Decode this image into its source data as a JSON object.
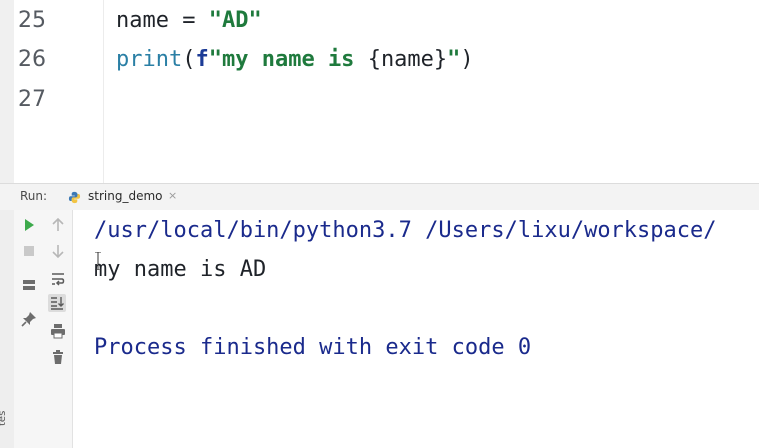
{
  "editor": {
    "lines": [
      {
        "number": "25",
        "tokens": {
          "ident": "name",
          "op": " = ",
          "str": "\"AD\""
        }
      },
      {
        "number": "26",
        "tokens": {
          "builtin": "print",
          "open": "(",
          "prefix": "f",
          "str1": "\"my name is ",
          "brace_open": "{",
          "var": "name",
          "brace_close": "}",
          "str2": "\"",
          "close": ")"
        }
      },
      {
        "number": "27"
      }
    ]
  },
  "run_window": {
    "label": "Run:",
    "tab": {
      "title": "string_demo",
      "close": "×",
      "icon": "python-icon"
    },
    "toolbar": [
      "run-icon",
      "stop-icon",
      "layout-icon",
      "pin-icon",
      "up-arrow-icon",
      "down-arrow-icon",
      "soft-wrap-icon",
      "scroll-to-end-icon",
      "print-icon",
      "trash-icon"
    ]
  },
  "console": {
    "command": "/usr/local/bin/python3.7 /Users/lixu/workspace/",
    "output": "my name is AD",
    "exit_message": "Process finished with exit code 0"
  },
  "edge_label": "tes",
  "colors": {
    "string": "#1f7a3d",
    "builtin": "#2a7fa5",
    "fprefix": "#1c3b96",
    "console_blue": "#1a2a8c",
    "run_green": "#3daa4c"
  }
}
